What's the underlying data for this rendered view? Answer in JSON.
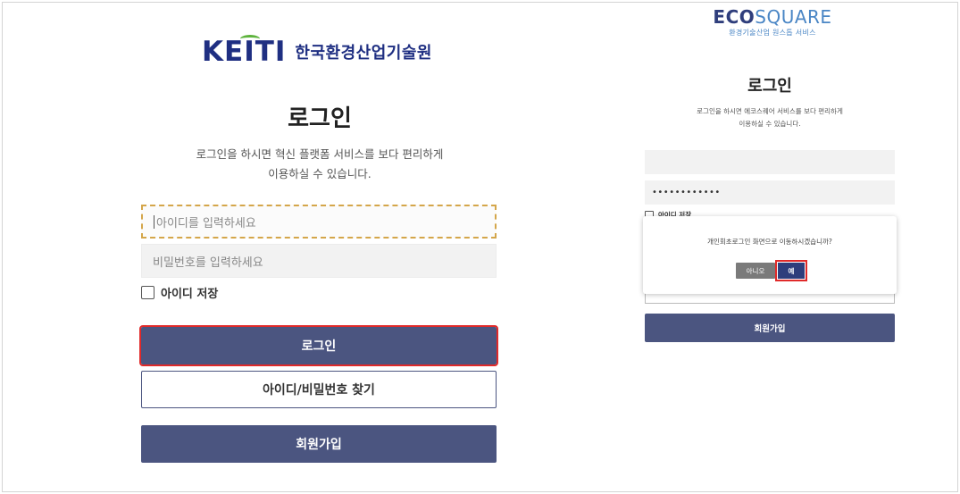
{
  "left": {
    "logo": {
      "mark": "KEITI",
      "name": "한국환경산업기술원"
    },
    "title": "로그인",
    "desc_line1": "로그인을 하시면 혁신 플랫폼 서비스를 보다 편리하게",
    "desc_line2": "이용하실 수 있습니다.",
    "id_placeholder": "아이디를 입력하세요",
    "pw_placeholder": "비밀번호를 입력하세요",
    "remember_label": "아이디 저장",
    "login_button": "로그인",
    "find_button": "아이디/비밀번호 찾기",
    "signup_button": "회원가입"
  },
  "right": {
    "logo": {
      "eco": "ECO",
      "square": "SQUARE",
      "sub": "환경기술산업 원스톱 서비스"
    },
    "title": "로그인",
    "desc_line1": "로그인을 하시면 에코스퀘어 서비스를 보다 편리하게",
    "desc_line2": "이용하실 수 있습니다.",
    "id_value": "",
    "pw_value": "••••••••••••",
    "remember_label": "아이디 저장",
    "signup_button": "회원가입",
    "dialog": {
      "message": "개인회초로그인 화면으로 이동하시겠습니까?",
      "no_button": "아니오",
      "yes_button": "예"
    }
  },
  "colors": {
    "brand_navy": "#4b5580",
    "keiti_blue": "#1f2f82",
    "keiti_green": "#5eb33d",
    "highlight_red": "#e02a2a"
  }
}
